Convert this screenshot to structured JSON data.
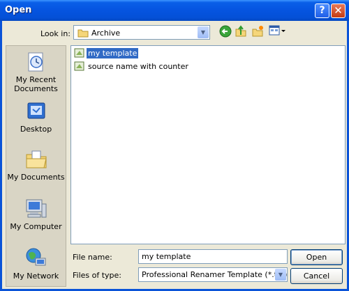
{
  "window": {
    "title": "Open",
    "help_glyph": "?",
    "close_glyph": "✕"
  },
  "toolbar": {
    "look_in_label": "Look in:",
    "look_in_value": "Archive",
    "icons": [
      "back-icon",
      "up-folder-icon",
      "new-folder-icon",
      "views-menu-icon"
    ]
  },
  "places": [
    {
      "label": "My Recent Documents",
      "icon": "recent-documents-icon"
    },
    {
      "label": "Desktop",
      "icon": "desktop-icon"
    },
    {
      "label": "My Documents",
      "icon": "my-documents-icon"
    },
    {
      "label": "My Computer",
      "icon": "my-computer-icon"
    },
    {
      "label": "My Network",
      "icon": "my-network-icon"
    }
  ],
  "files": [
    {
      "name": "my template",
      "selected": true,
      "icon": "template-file-icon"
    },
    {
      "name": "source name with counter",
      "selected": false,
      "icon": "template-file-icon"
    }
  ],
  "form": {
    "file_name_label": "File name:",
    "file_name_value": "my template",
    "file_type_label": "Files of type:",
    "file_type_value": "Professional Renamer Template (*.tpl)"
  },
  "buttons": {
    "open": "Open",
    "cancel": "Cancel"
  },
  "colors": {
    "titlebar": "#0554e0",
    "selection": "#316ac5",
    "dialog_bg": "#ece9d8"
  }
}
